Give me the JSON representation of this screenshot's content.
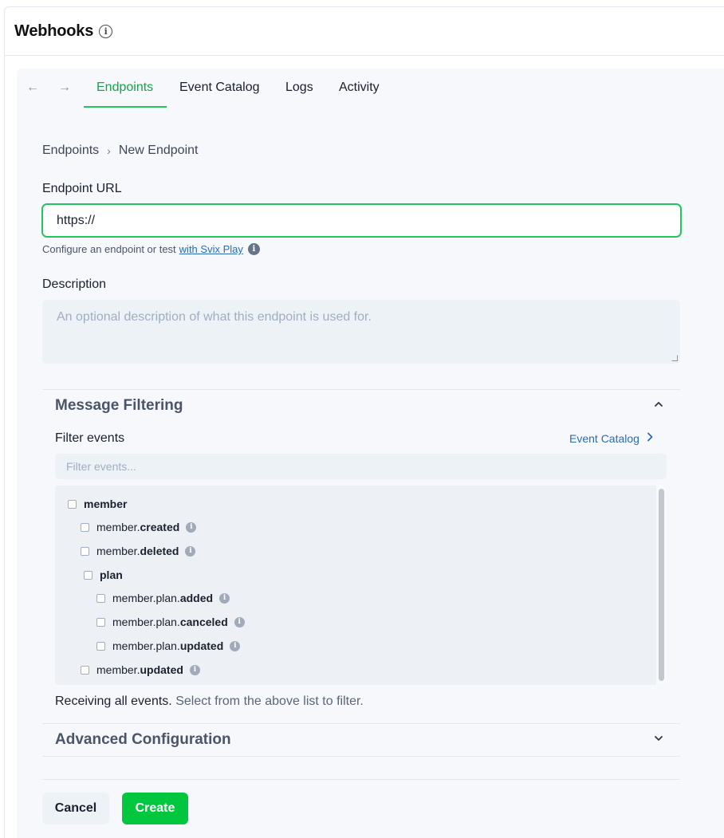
{
  "header": {
    "title": "Webhooks",
    "info_glyph": "i"
  },
  "nav": {
    "back_glyph": "←",
    "forward_glyph": "→",
    "tabs": [
      {
        "label": "Endpoints",
        "active": true
      },
      {
        "label": "Event Catalog",
        "active": false
      },
      {
        "label": "Logs",
        "active": false
      },
      {
        "label": "Activity",
        "active": false
      }
    ]
  },
  "breadcrumb": {
    "parent": "Endpoints",
    "separator": "›",
    "current": "New Endpoint"
  },
  "form": {
    "endpoint_url_label": "Endpoint URL",
    "endpoint_url_value": "https://",
    "helper_text": "Configure an endpoint or test",
    "helper_link": "with Svix Play",
    "description_label": "Description",
    "description_placeholder": "An optional description of what this endpoint is used for."
  },
  "message_filtering": {
    "title": "Message Filtering",
    "expanded": true,
    "filter_label": "Filter events",
    "catalog_link": "Event Catalog",
    "filter_placeholder": "Filter events...",
    "events": [
      {
        "prefix": "",
        "bold": "member",
        "info": false
      },
      {
        "prefix": "member.",
        "bold": "created",
        "info": true
      },
      {
        "prefix": "member.",
        "bold": "deleted",
        "info": true
      },
      {
        "prefix": "",
        "bold": "plan",
        "info": false
      },
      {
        "prefix": "member.plan.",
        "bold": "added",
        "info": true
      },
      {
        "prefix": "member.plan.",
        "bold": "canceled",
        "info": true
      },
      {
        "prefix": "member.plan.",
        "bold": "updated",
        "info": true
      },
      {
        "prefix": "member.",
        "bold": "updated",
        "info": true
      }
    ],
    "receiving_strong": "Receiving all events.",
    "receiving_muted": "Select from the above list to filter."
  },
  "advanced": {
    "title": "Advanced Configuration",
    "expanded": false
  },
  "actions": {
    "cancel_label": "Cancel",
    "create_label": "Create"
  },
  "colors": {
    "accent": "#22c55e",
    "create_button": "#00c73d",
    "link": "#2b6cb0"
  }
}
